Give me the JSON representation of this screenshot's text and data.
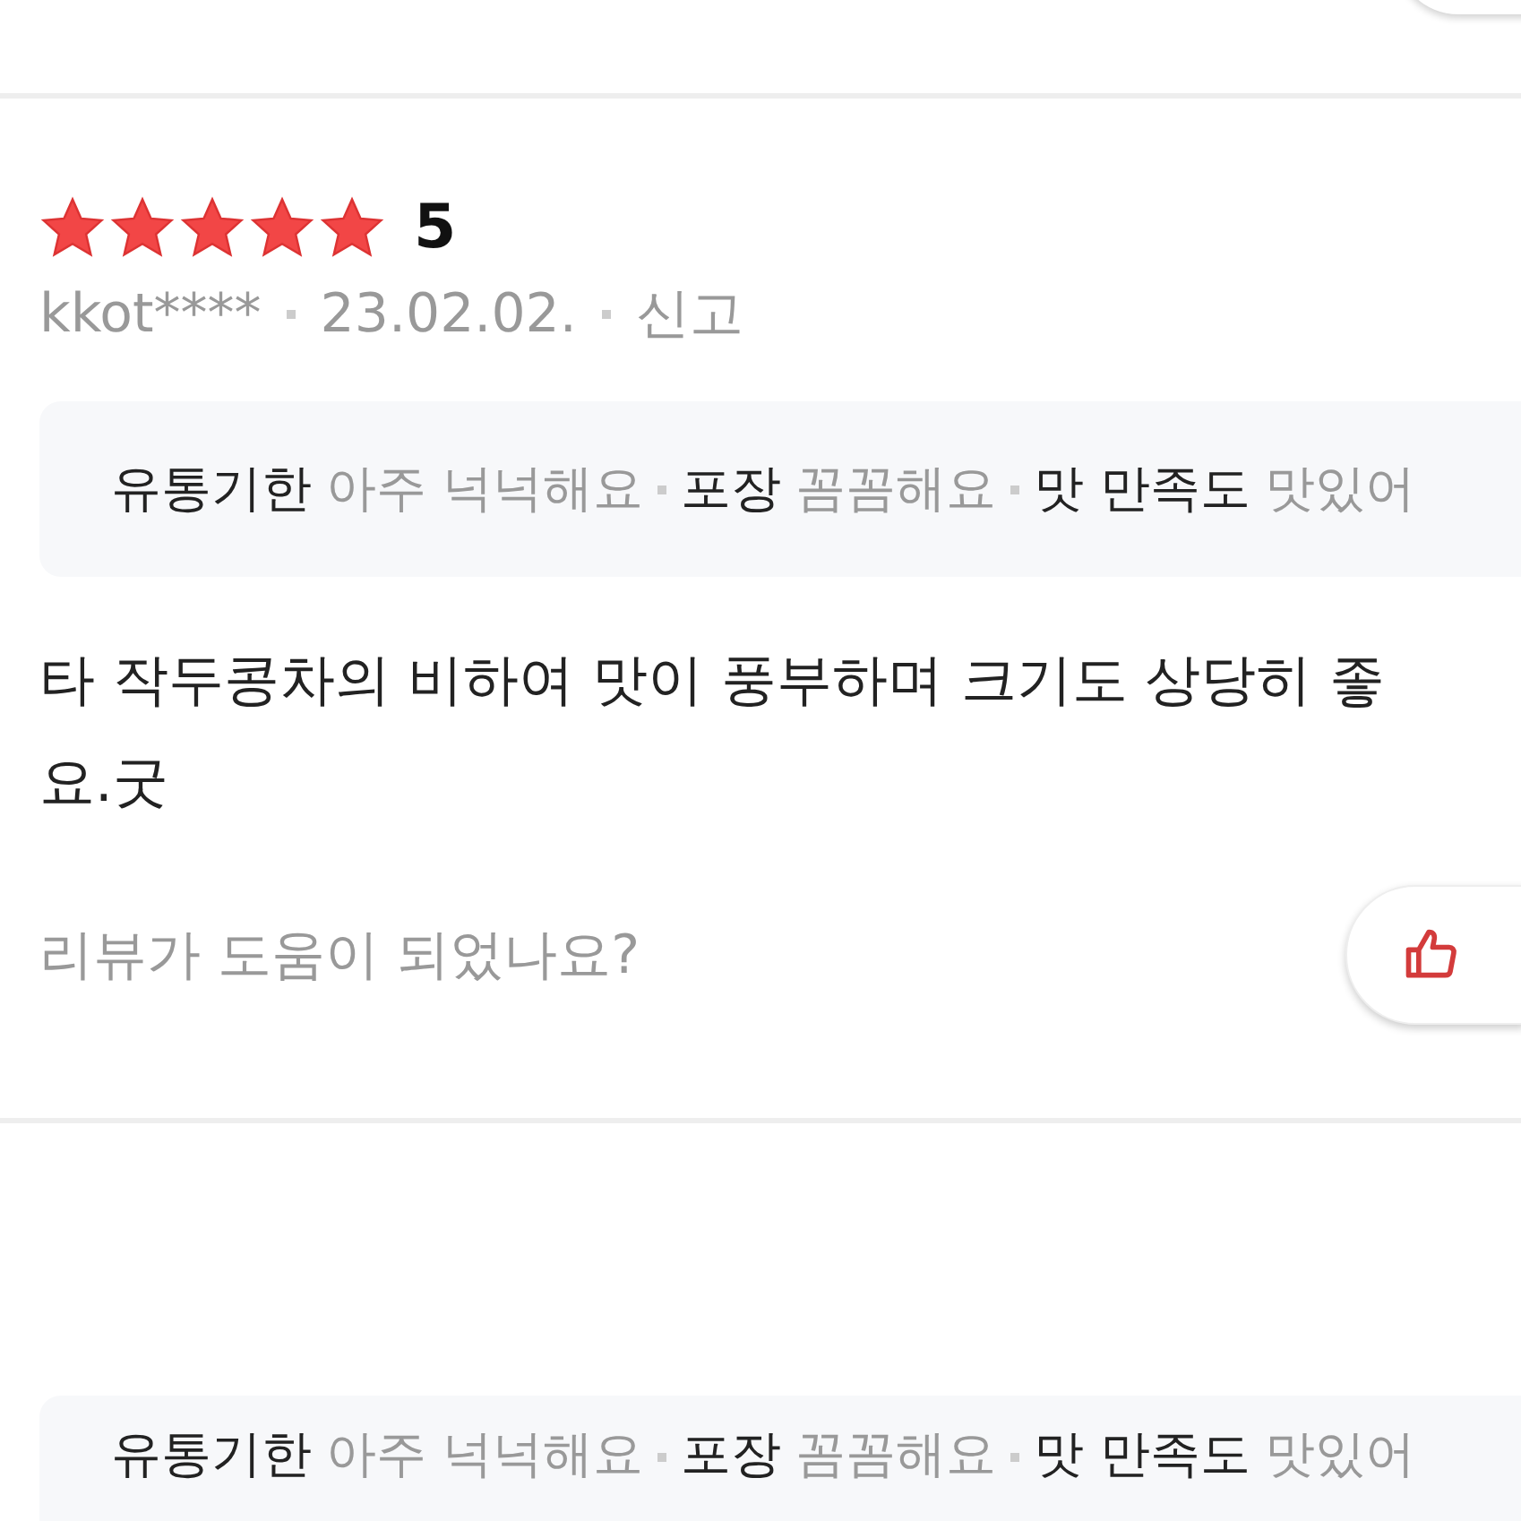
{
  "review": {
    "stars": 5,
    "score": "5",
    "author": "kkot****",
    "date": "23.02.02.",
    "report": "신고",
    "tags": [
      {
        "label": "유통기한",
        "value": "아주 넉넉해요"
      },
      {
        "label": "포장",
        "value": "꼼꼼해요"
      },
      {
        "label": "맛 만족도",
        "value": "맛있어"
      }
    ],
    "body_lines": [
      "타 작두콩차의 비하여 맛이 풍부하며 크기도 상당히 좋",
      "요.굿"
    ],
    "helpful_prompt": "리뷰가 도움이 되었나요?"
  },
  "next_review": {
    "tags": [
      {
        "label": "유통기한",
        "value": "아주 넉넉해요"
      },
      {
        "label": "포장",
        "value": "꼼꼼해요"
      },
      {
        "label": "맛 만족도",
        "value": "맛있어"
      }
    ]
  }
}
